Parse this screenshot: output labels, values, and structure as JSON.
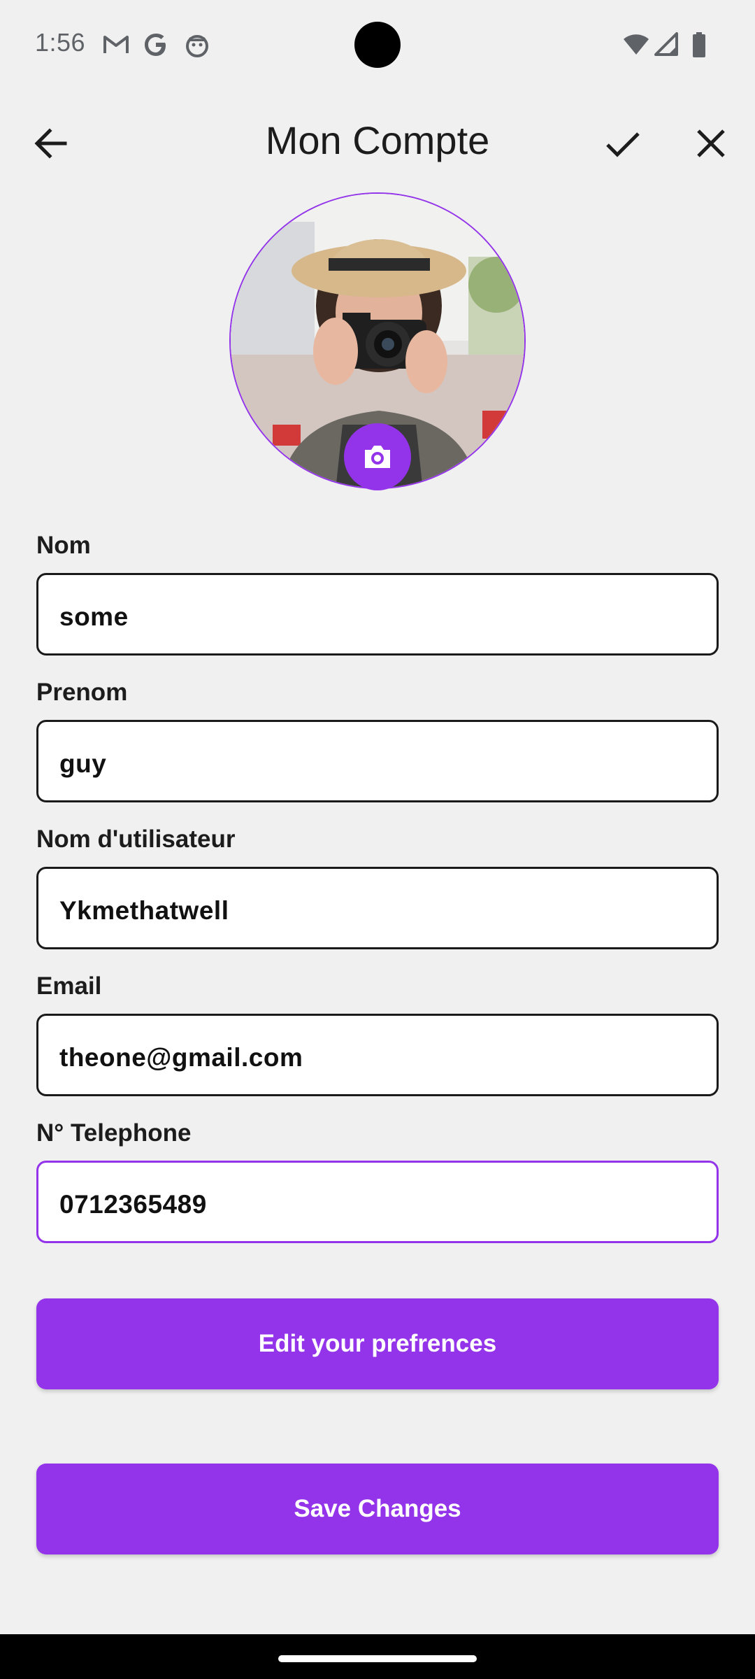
{
  "status_bar": {
    "time": "1:56",
    "left_icons": [
      "gmail-icon",
      "google-icon",
      "android-icon"
    ],
    "right_icons": [
      "wifi-icon",
      "signal-icon",
      "battery-icon"
    ]
  },
  "app_bar": {
    "title": "Mon Compte",
    "back_icon": "arrow-back-icon",
    "confirm_icon": "check-icon",
    "close_icon": "close-icon"
  },
  "profile": {
    "camera_icon": "camera-icon"
  },
  "form": {
    "fields": [
      {
        "label": "Nom",
        "value": "some"
      },
      {
        "label": "Prenom",
        "value": "guy"
      },
      {
        "label": "Nom d'utilisateur",
        "value": "Ykmethatwell"
      },
      {
        "label": "Email",
        "value": "theone@gmail.com"
      },
      {
        "label": "N° Telephone",
        "value": "0712365489"
      }
    ]
  },
  "buttons": {
    "preferences": "Edit your prefrences",
    "save": "Save Changes"
  },
  "colors": {
    "accent": "#9333ea",
    "background": "#f0f0f0",
    "text": "#1c1c1c"
  }
}
